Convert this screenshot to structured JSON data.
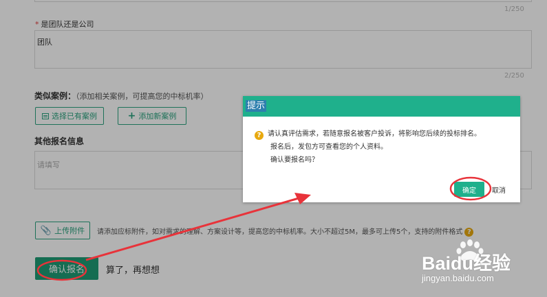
{
  "form": {
    "top_count": "1/250",
    "team_label": "是团队还是公司",
    "team_value": "团队",
    "team_count": "2/250",
    "cases_title": "类似案例：",
    "cases_hint": "（添加相关案例，可提高您的中标机率）",
    "select_case_label": "选择已有案例",
    "add_case_label": "添加新案例",
    "other_title": "其他报名信息",
    "other_placeholder": "请填写",
    "upload_label": "上传附件",
    "upload_hint": "请添加应标附件，如对需求的理解、方案设计等，提高您的中标机率。大小不超过5M，最多可上传5个，支持的附件格式",
    "confirm_label": "确认报名",
    "later_label": "算了，再想想"
  },
  "dialog": {
    "title": "提示",
    "line1": "请认真评估需求，若随意报名被客户投诉，将影响您后续的投标排名。",
    "line2": "报名后，发包方可查看您的个人资料。",
    "line3": "确认要报名吗？",
    "ok_label": "确定",
    "cancel_label": "取消"
  },
  "watermark": {
    "brand": "Baidu经验",
    "url": "jingyan.baidu.com"
  },
  "colors": {
    "accent": "#1fb08c",
    "annotation": "#e8333a",
    "warn": "#e8a90f"
  }
}
